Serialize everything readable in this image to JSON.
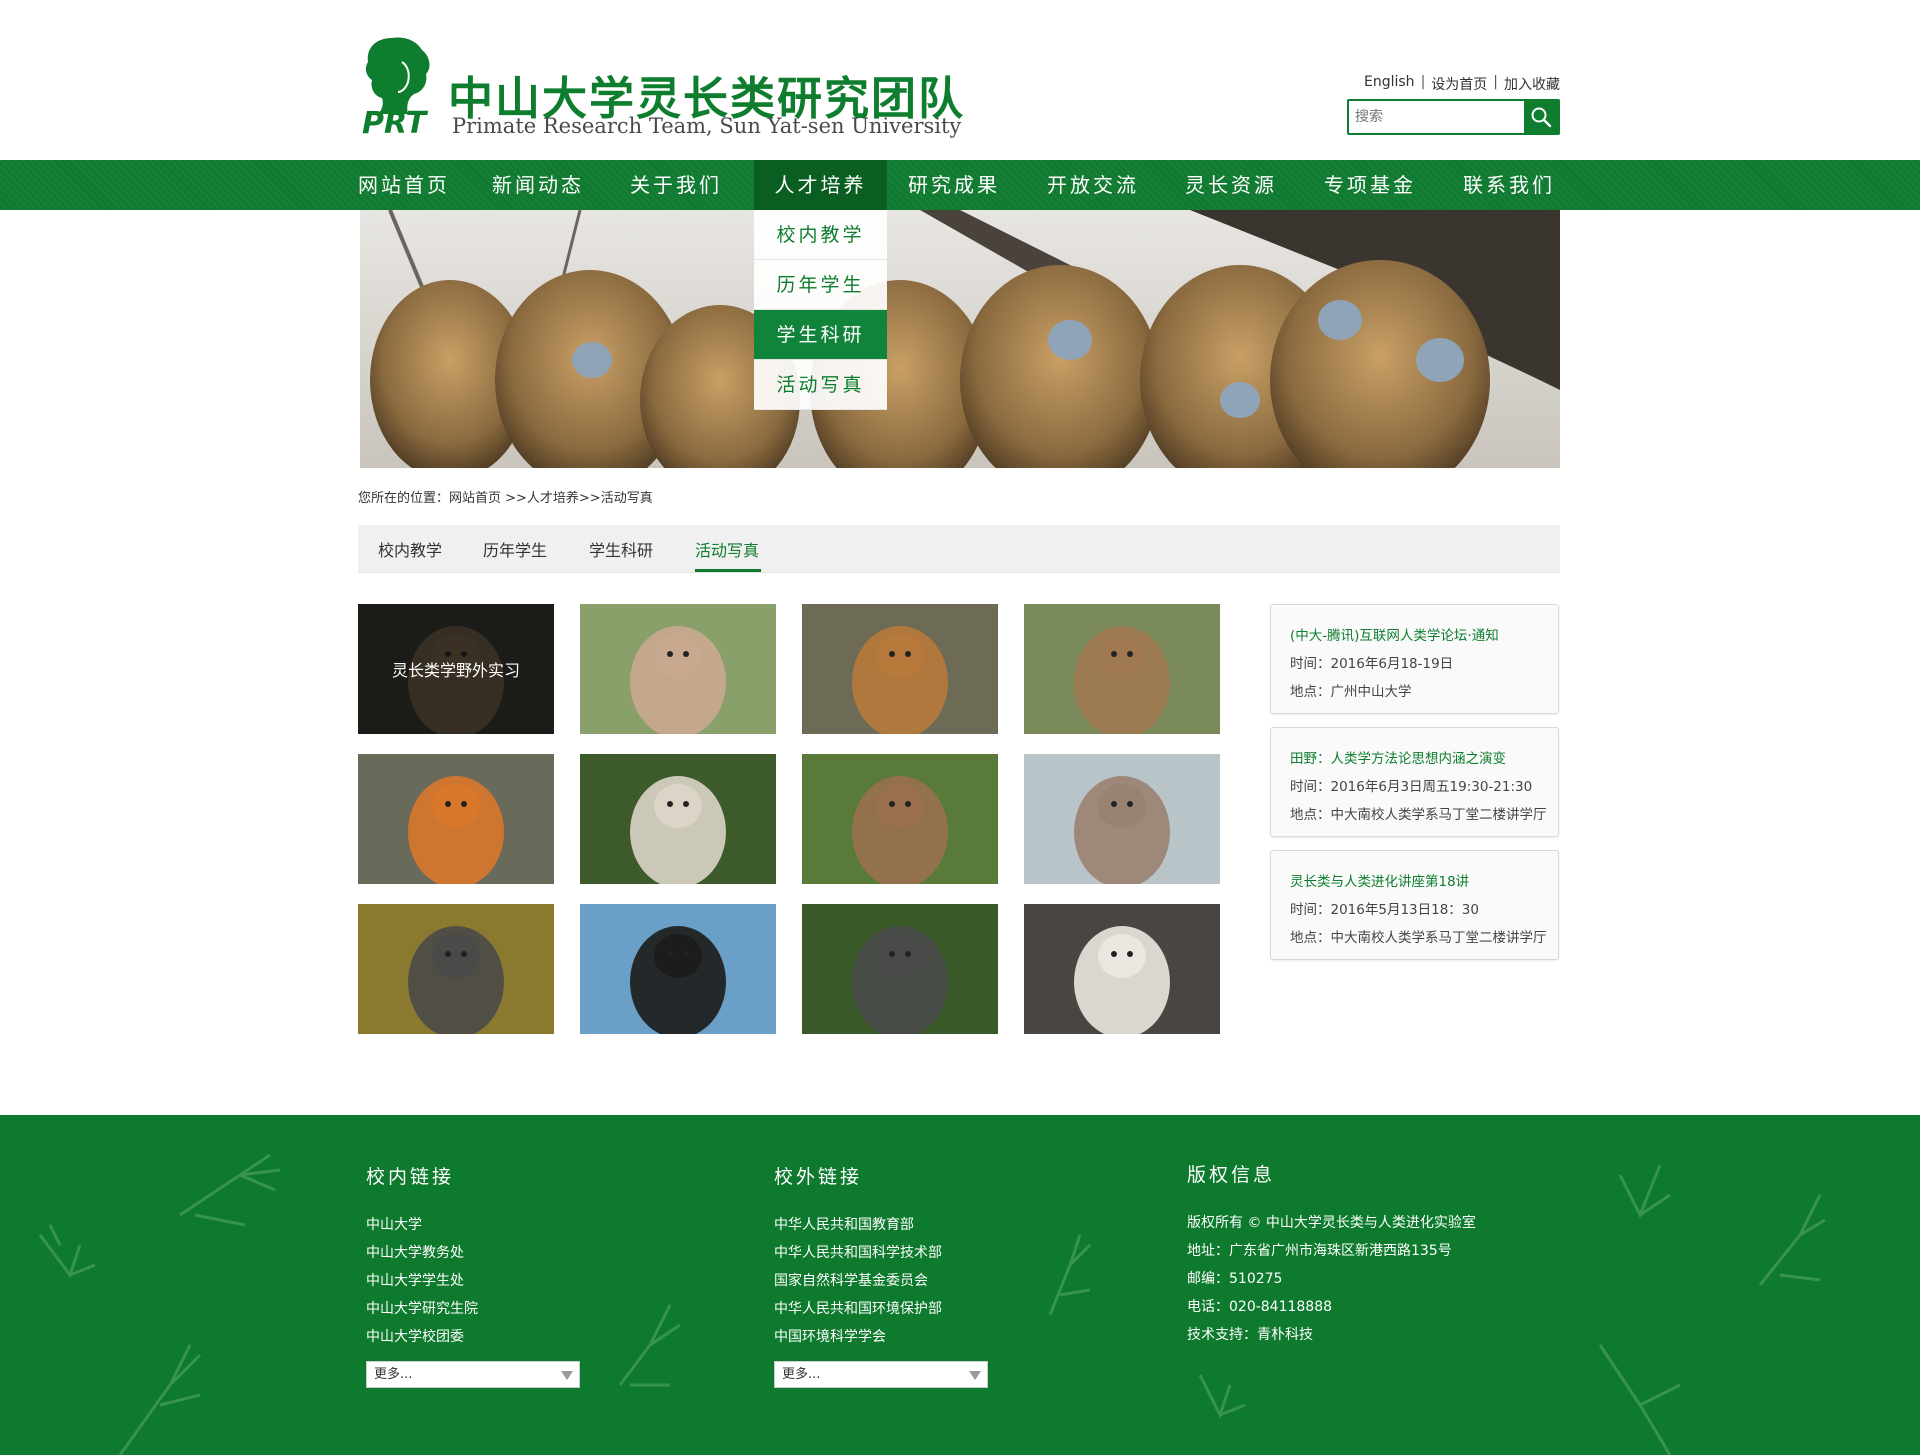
{
  "header": {
    "logo_abbr": "PRT",
    "logo_title": "中山大学灵长类研究团队",
    "logo_subtitle": "Primate Research Team, Sun Yat-sen University",
    "top_links": [
      "English",
      "设为首页",
      "加入收藏"
    ],
    "search_placeholder": "搜索"
  },
  "nav": {
    "items": [
      "网站首页",
      "新闻动态",
      "关于我们",
      "人才培养",
      "研究成果",
      "开放交流",
      "灵长资源",
      "专项基金",
      "联系我们"
    ],
    "active": "人才培养",
    "dropdown": [
      "校内教学",
      "历年学生",
      "学生科研",
      "活动写真"
    ],
    "dropdown_active": "学生科研"
  },
  "breadcrumb": "您所在的位置：网站首页 >>人才培养>>活动写真",
  "subtabs": {
    "items": [
      "校内教学",
      "历年学生",
      "学生科研",
      "活动写真"
    ],
    "active": "活动写真"
  },
  "gallery": {
    "first_caption": "灵长类学野外实习",
    "photos": [
      "capuchin-monkey",
      "macaque-face",
      "langur-on-branch",
      "barbary-macaque",
      "golden-monkey-lying",
      "white-gibbon",
      "young-macaque",
      "snow-monkeys-hugging",
      "gorilla-portrait",
      "gorilla-silhouette",
      "gorilla-with-sprout",
      "monkey-with-dove"
    ]
  },
  "events": [
    {
      "title": "(中大-腾讯)互联网人类学论坛·通知",
      "time": "时间：2016年6月18-19日",
      "place": "地点：广州中山大学"
    },
    {
      "title": "田野：人类学方法论思想内涵之演变",
      "time": "时间：2016年6月3日周五19:30-21:30",
      "place": "地点：中大南校人类学系马丁堂二楼讲学厅"
    },
    {
      "title": "灵长类与人类进化讲座第18讲",
      "time": "时间：2016年5月13日18：30",
      "place": "地点：中大南校人类学系马丁堂二楼讲学厅"
    }
  ],
  "footer": {
    "internal": {
      "heading": "校内链接",
      "links": [
        "中山大学",
        "中山大学教务处",
        "中山大学学生处",
        "中山大学研究生院",
        "中山大学校团委"
      ],
      "more": "更多..."
    },
    "external": {
      "heading": "校外链接",
      "links": [
        "中华人民共和国教育部",
        "中华人民共和国科学技术部",
        "国家自然科学基金委员会",
        "中华人民共和国环境保护部",
        "中国环境科学学会"
      ],
      "more": "更多..."
    },
    "copyright": {
      "heading": "版权信息",
      "lines": [
        "版权所有 © 中山大学灵长类与人类进化实验室",
        "地址：广东省广州市海珠区新港西路135号",
        "邮编：510275",
        "电话：020-84118888",
        "技术支持：青朴科技"
      ]
    }
  },
  "colors": {
    "brand_green": "#0e7d2e",
    "nav_active": "#0a5e22",
    "footer_bg": "#0d7a2d"
  }
}
